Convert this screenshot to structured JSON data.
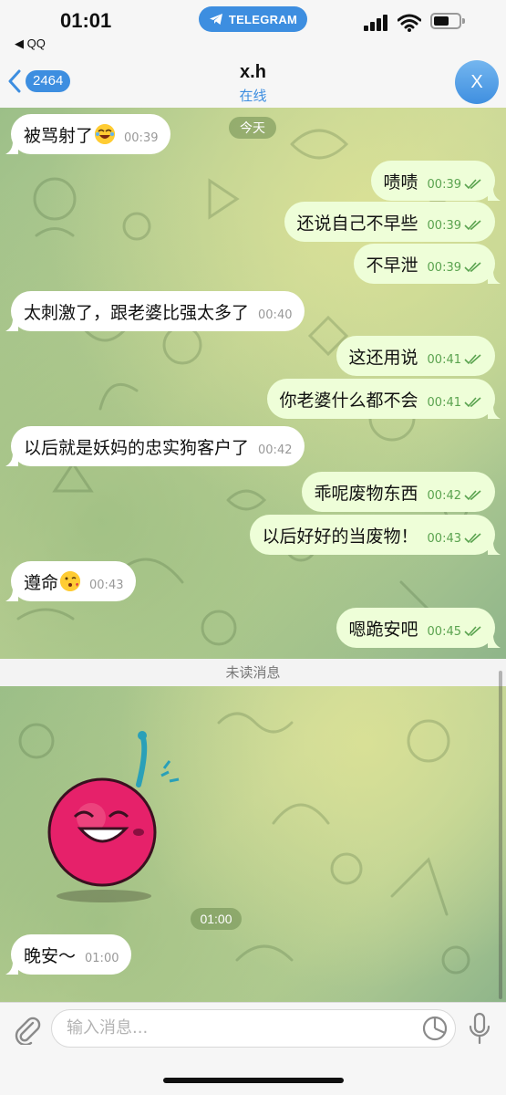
{
  "status_bar": {
    "time": "01:01",
    "back_app": "◀ QQ",
    "app_pill": "TELEGRAM"
  },
  "header": {
    "back_count": "2464",
    "title": "x.h",
    "status": "在线",
    "avatar_letter": "X"
  },
  "date_separator": "今天",
  "messages": [
    {
      "dir": "in",
      "text": "被骂射了",
      "time": "00:39",
      "emoji": "joy-emoji"
    },
    {
      "dir": "out",
      "text": "啧啧",
      "time": "00:39"
    },
    {
      "dir": "out",
      "text": "还说自己不早些",
      "time": "00:39"
    },
    {
      "dir": "out",
      "text": "不早泄",
      "time": "00:39"
    },
    {
      "dir": "in",
      "text": "太刺激了，跟老婆比强太多了",
      "time": "00:40"
    },
    {
      "dir": "out",
      "text": "这还用说",
      "time": "00:41"
    },
    {
      "dir": "out",
      "text": "你老婆什么都不会",
      "time": "00:41"
    },
    {
      "dir": "in",
      "text": "以后就是妖妈的忠实狗客户了",
      "time": "00:42"
    },
    {
      "dir": "out",
      "text": "乖呢废物东西",
      "time": "00:42"
    },
    {
      "dir": "out",
      "text": "以后好好的当废物！",
      "time": "00:43"
    },
    {
      "dir": "in",
      "text": "遵命",
      "time": "00:43",
      "emoji": "kiss-emoji"
    },
    {
      "dir": "out",
      "text": "嗯跪安吧",
      "time": "00:45"
    }
  ],
  "unread_label": "未读消息",
  "sticker": {
    "icon": "cherry-sticker",
    "time": "01:00"
  },
  "last_message": {
    "dir": "in",
    "text": "晚安～",
    "time": "01:00"
  },
  "input": {
    "placeholder": "输入消息..."
  },
  "colors": {
    "accent": "#3d8ee0",
    "outgoing": "#eefed8",
    "incoming": "#ffffff",
    "read_check": "#5aa34f"
  }
}
